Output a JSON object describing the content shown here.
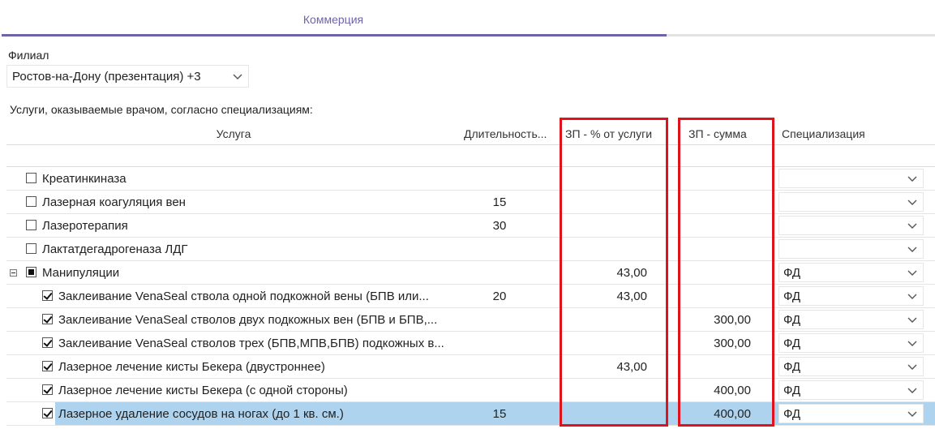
{
  "tabs": {
    "active_label": "Коммерция"
  },
  "branch": {
    "label": "Филиал",
    "value": "Ростов-на-Дону (презентация) +3"
  },
  "services_caption": "Услуги, оказываемые врачом, согласно специализациям:",
  "columns": {
    "service": "Услуга",
    "duration": "Длительность...",
    "salary_percent": "ЗП - % от услуги",
    "salary_sum": "ЗП - сумма",
    "specialization": "Специализация"
  },
  "rows": [
    {
      "name": "Креатинкиназа",
      "duration": "",
      "salary_percent": "",
      "salary_sum": "",
      "specialization": "",
      "checked": "unchecked",
      "level": 0
    },
    {
      "name": "Лазерная коагуляция вен",
      "duration": "15",
      "salary_percent": "",
      "salary_sum": "",
      "specialization": "",
      "checked": "unchecked",
      "level": 0
    },
    {
      "name": "Лазеротерапия",
      "duration": "30",
      "salary_percent": "",
      "salary_sum": "",
      "specialization": "",
      "checked": "unchecked",
      "level": 0
    },
    {
      "name": "Лактатдегадрогеназа ЛДГ",
      "duration": "",
      "salary_percent": "",
      "salary_sum": "",
      "specialization": "",
      "checked": "unchecked",
      "level": 0
    },
    {
      "name": "Манипуляции",
      "duration": "",
      "salary_percent": "43,00",
      "salary_sum": "",
      "specialization": "ФД",
      "checked": "indeterminate",
      "level": 0,
      "expandable": true
    },
    {
      "name": "Заклеивание VenaSeal ствола одной подкожной вены (БПВ или...",
      "duration": "20",
      "salary_percent": "43,00",
      "salary_sum": "",
      "specialization": "ФД",
      "checked": "checked",
      "level": 1
    },
    {
      "name": "Заклеивание VenaSeal стволов двух подкожных вен (БПВ и БПВ,...",
      "duration": "",
      "salary_percent": "",
      "salary_sum": "300,00",
      "specialization": "ФД",
      "checked": "checked",
      "level": 1
    },
    {
      "name": "Заклеивание VenaSeal стволов трех (БПВ,МПВ,БПВ) подкожных в...",
      "duration": "",
      "salary_percent": "",
      "salary_sum": "300,00",
      "specialization": "ФД",
      "checked": "checked",
      "level": 1
    },
    {
      "name": "Лазерное лечение кисты Бекера (двустроннее)",
      "duration": "",
      "salary_percent": "43,00",
      "salary_sum": "",
      "specialization": "ФД",
      "checked": "checked",
      "level": 1
    },
    {
      "name": "Лазерное лечение кисты Бекера (с одной стороны)",
      "duration": "",
      "salary_percent": "",
      "salary_sum": "400,00",
      "specialization": "ФД",
      "checked": "checked",
      "level": 1
    },
    {
      "name": "Лазерное удаление сосудов на ногах (до 1 кв. см.)",
      "duration": "15",
      "salary_percent": "",
      "salary_sum": "400,00",
      "specialization": "ФД",
      "checked": "checked",
      "level": 1,
      "selected": true
    }
  ],
  "icons": {
    "dropdown": "chevron-down-icon",
    "expander": "collapse-minus-icon"
  },
  "colors": {
    "accent": "#6f64a8",
    "selection": "#add3ee",
    "highlight": "#e0121b"
  }
}
